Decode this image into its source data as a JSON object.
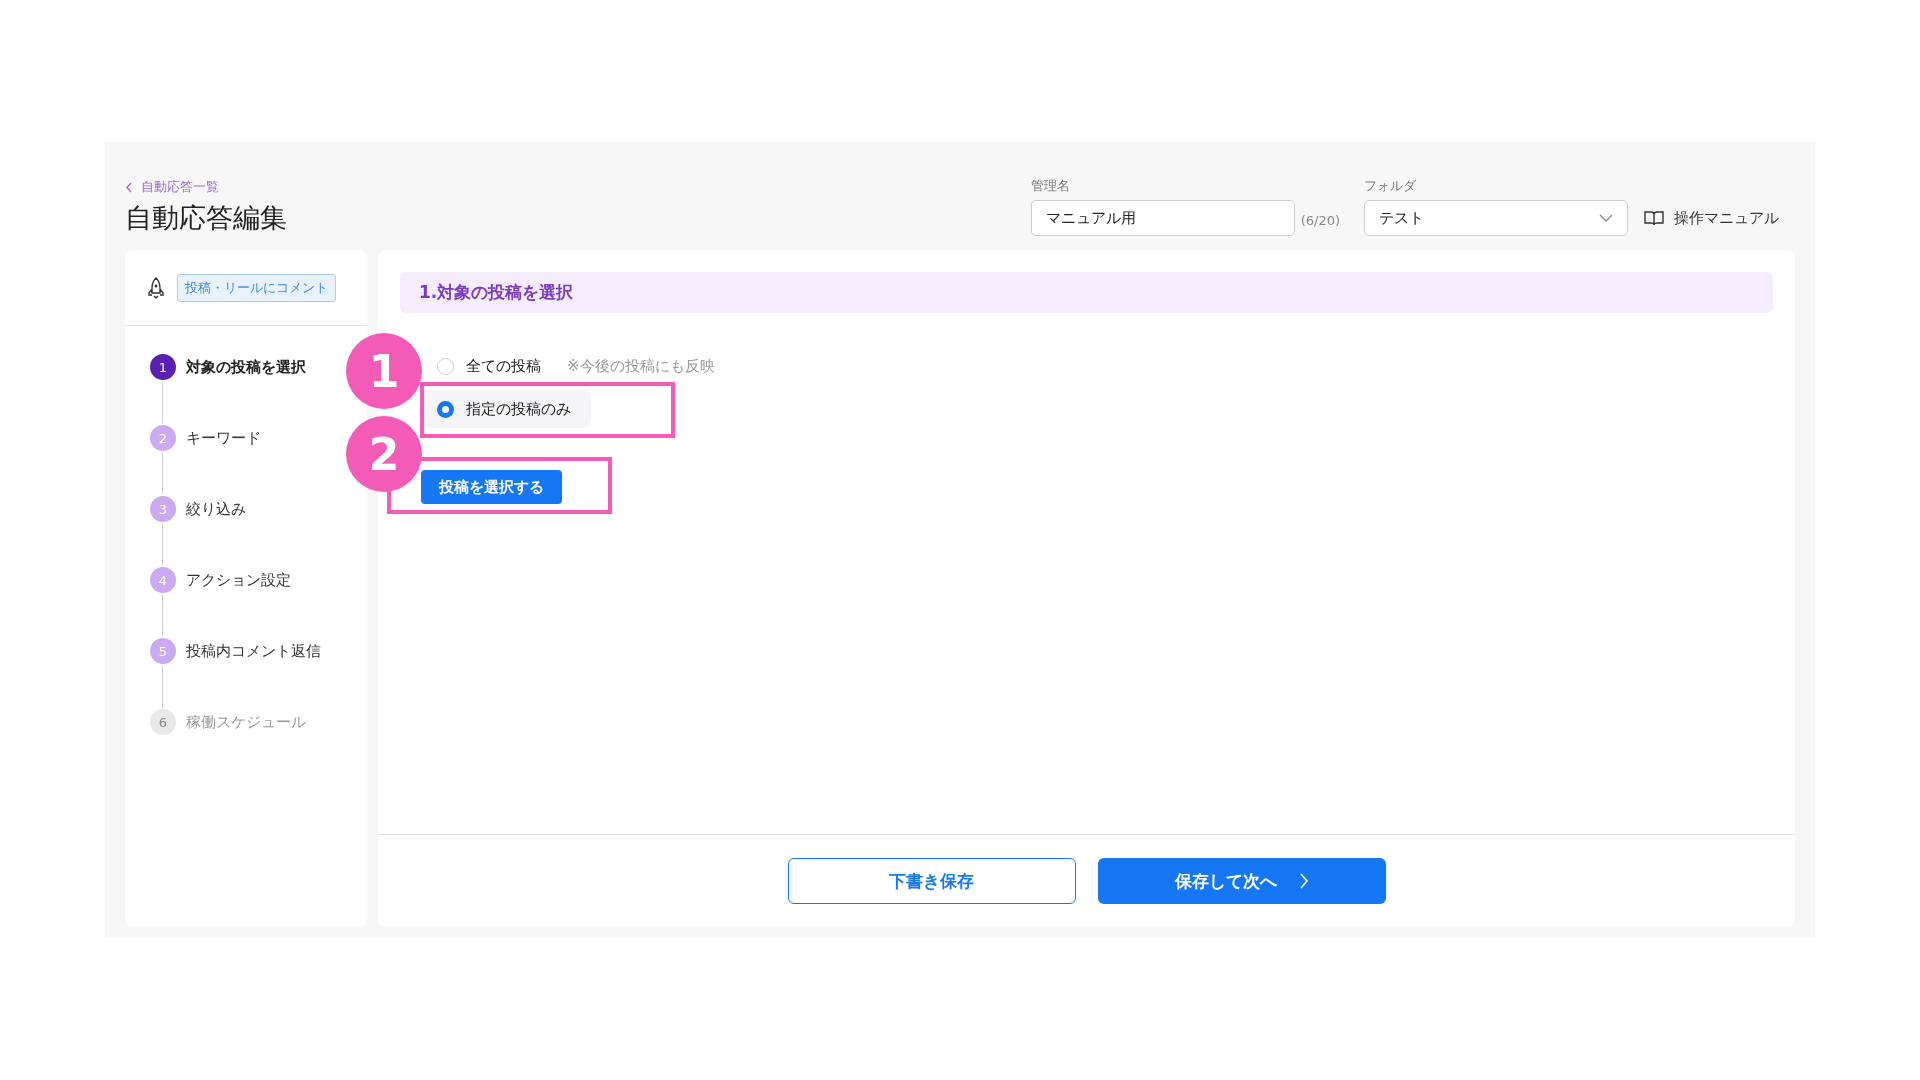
{
  "header": {
    "back_link": "自動応答一覧",
    "title": "自動応答編集",
    "name_field": {
      "label": "管理名",
      "value": "マニュアル用",
      "counter": "(6/20)"
    },
    "folder_select": {
      "label": "フォルダ",
      "value": "テスト"
    },
    "manual_link": "操作マニュアル"
  },
  "sidebar": {
    "trigger_tag": "投稿・リールにコメント",
    "steps": [
      {
        "number": "1",
        "label": "対象の投稿を選択",
        "selected": true,
        "disabled": false
      },
      {
        "number": "2",
        "label": "キーワード",
        "selected": false,
        "disabled": false
      },
      {
        "number": "3",
        "label": "絞り込み",
        "selected": false,
        "disabled": false
      },
      {
        "number": "4",
        "label": "アクション設定",
        "selected": false,
        "disabled": false
      },
      {
        "number": "5",
        "label": "投稿内コメント返信",
        "selected": false,
        "disabled": false
      },
      {
        "number": "6",
        "label": "稼働スケジュール",
        "selected": false,
        "disabled": true
      }
    ]
  },
  "section": {
    "title": "1.対象の投稿を選択",
    "options": [
      {
        "label": "全ての投稿",
        "note": "※今後の投稿にも反映",
        "selected": false
      },
      {
        "label": "指定の投稿のみ",
        "selected": true
      }
    ],
    "select_button": "投稿を選択する"
  },
  "annotations": [
    {
      "label": "1"
    },
    {
      "label": "2"
    }
  ],
  "footer": {
    "draft_button": "下書き保存",
    "next_button": "保存して次へ"
  }
}
